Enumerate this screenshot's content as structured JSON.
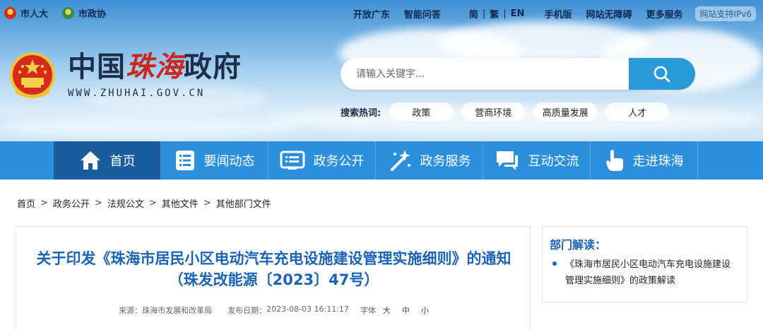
{
  "topbar": {
    "left_links": [
      {
        "label": "市人大",
        "icon": "emblem-icon"
      },
      {
        "label": "市政协",
        "icon": "cppcc-emblem-icon"
      }
    ],
    "right_links": [
      "开放广东",
      "智能问答"
    ],
    "lang": [
      "简",
      "繁",
      "EN"
    ],
    "more_links": [
      "手机版",
      "网站无障碍",
      "更多服务"
    ],
    "ipv6": "网站支持IPv6"
  },
  "logo": {
    "title_prefix": "中国",
    "title_city": "珠海",
    "title_suffix": "政府",
    "url": "WWW.ZHUHAI.GOV.CN"
  },
  "search": {
    "placeholder": "请输入关键字...",
    "hot_label": "搜索热词:",
    "hot_tags": [
      "政策",
      "营商环境",
      "高质量发展",
      "人才"
    ]
  },
  "nav": {
    "items": [
      {
        "label": "首页",
        "icon": "home-icon"
      },
      {
        "label": "要闻动态",
        "icon": "news-list-icon"
      },
      {
        "label": "政务公开",
        "icon": "open-affairs-icon"
      },
      {
        "label": "政务服务",
        "icon": "service-magic-icon"
      },
      {
        "label": "互动交流",
        "icon": "chat-icon"
      },
      {
        "label": "走进珠海",
        "icon": "hand-pointer-icon"
      }
    ]
  },
  "breadcrumb": [
    "首页",
    "政务公开",
    "法规公文",
    "其他文件",
    "其他部门文件"
  ],
  "article": {
    "title_line1": "关于印发《珠海市居民小区电动汽车充电设施建设管理实施细则》的通知",
    "title_line2": "（珠发改能源〔2023〕47号）",
    "source_label": "来源：",
    "source": "珠海市发展和改革局",
    "date_label": "发布日期：",
    "date": "2023-08-03 16:11:17",
    "font_label": "字体",
    "font_sizes": [
      "大",
      "中",
      "小"
    ]
  },
  "side": {
    "title": "部门解读：",
    "link": "《珠海市居民小区电动汽车充电设施建设管理实施细则》的政策解读"
  },
  "colors": {
    "nav_bg": "#2c8fdb",
    "nav_active": "#1a5d9e",
    "title_blue": "#1b63b5",
    "search_btn": "#2a9ad8"
  }
}
